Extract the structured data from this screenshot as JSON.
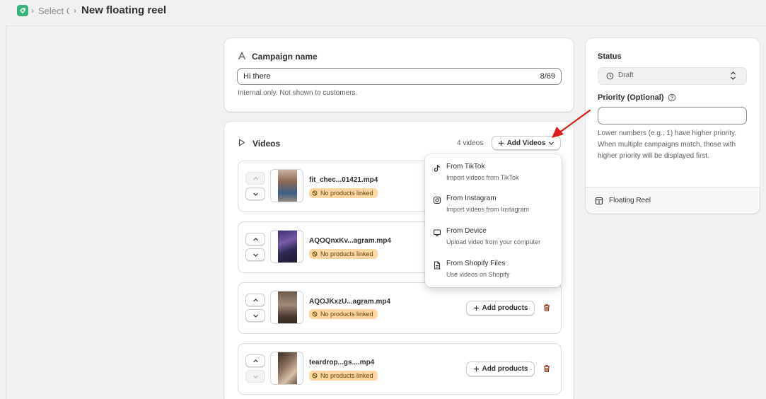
{
  "header": {
    "breadcrumb_select": "Select C",
    "page_title": "New floating reel"
  },
  "campaign": {
    "title": "Campaign name",
    "value": "Hi there",
    "counter": "8/69",
    "helper": "Internal only. Not shown to customers."
  },
  "videos": {
    "title": "Videos",
    "count": "4 videos",
    "add_label": "Add Videos",
    "items": [
      {
        "name": "fit_chec...01421.mp4",
        "badge": "No products linked"
      },
      {
        "name": "AQOQnxKv...agram.mp4",
        "badge": "No products linked"
      },
      {
        "name": "AQOJKxzU...agram.mp4",
        "badge": "No products linked",
        "add_products": "Add products"
      },
      {
        "name": "teardrop...gs....mp4",
        "badge": "No products linked",
        "add_products": "Add products"
      }
    ]
  },
  "dropdown": {
    "items": [
      {
        "title": "From TikTok",
        "sub": "Import videos from TikTok",
        "icon": "tiktok-icon"
      },
      {
        "title": "From Instagram",
        "sub": "Import videos from Instagram",
        "icon": "instagram-icon"
      },
      {
        "title": "From Device",
        "sub": "Upload video from your computer",
        "icon": "monitor-icon"
      },
      {
        "title": "From Shopify Files",
        "sub": "Use videos on Shopify",
        "icon": "file-icon"
      }
    ]
  },
  "sidebar": {
    "status_label": "Status",
    "status_value": "Draft",
    "priority_label": "Priority (Optional)",
    "priority_value": "",
    "priority_help": "Lower numbers (e.g., 1) have higher priority. When multiple campaigns match, those with higher priority will be displayed first.",
    "footer_label": "Floating Reel"
  },
  "colors": {
    "badge_bg": "#ffd6a4",
    "trash": "#8e1f0b",
    "annotation_arrow": "#e01b1b",
    "app_icon": "#36b37e"
  }
}
